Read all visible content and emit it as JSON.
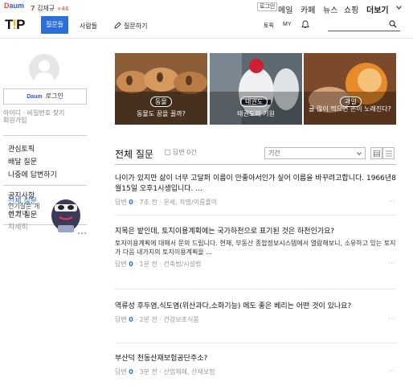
{
  "topbar": {
    "logo_d": "D",
    "logo_rest": "aum",
    "rank_num": "7",
    "rank_keyword": "김재규",
    "rank_change": "+46",
    "login_chip": "로그인",
    "services": [
      "메일",
      "카페",
      "뉴스",
      "쇼핑"
    ],
    "more": "더보기"
  },
  "header": {
    "logo_main": "T",
    "logo_accent": "!",
    "logo_end": "P",
    "tab_question": "질문들",
    "tab_people": "사람들",
    "ask_label": "질문하기",
    "link_topic": "토픽",
    "link_my": "MY"
  },
  "sidebar": {
    "login_daum": "Daum",
    "login_label": "로그인",
    "find_account": "아이디 · 비밀번호 찾기",
    "signup": "회원가입",
    "menu": [
      "관심토픽",
      "배달 질문",
      "나중에 답변하기"
    ],
    "menu2": [
      "전체 질문",
      "인기 질문"
    ],
    "notice_title": "공지사항",
    "notice_text": "인기질문 개선 안내",
    "notice_more": "자세히"
  },
  "cards": [
    {
      "badge": "동물",
      "caption": "동물도 꿈을 꿀까?"
    },
    {
      "badge": "태권도",
      "caption": "태권도의 기원"
    },
    {
      "badge": "과일",
      "caption": "귤 많이 먹으면 손이 노래진다?"
    }
  ],
  "list": {
    "title": "전체 질문",
    "answer_filter": "답변 0건",
    "period_label": "기간"
  },
  "questions": [
    {
      "title": "나이가 있지만 삶이 너무 고달퍼 이름이 안좋아서인가 싶어 이름을 바꾸려고합니다. 1966년8월15일 오후1시생입니다. ...",
      "body": "",
      "answers_label": "답변",
      "answers": "0",
      "time": "7초 전",
      "category": "운세, 작명/이름풀이"
    },
    {
      "title": "지목은 밭인데, 토지이용계획에는 국가하천으로 표기된 것은 하천인가요?",
      "body": "토지이용계획에 대해서 문의 드립니다. 현재, 부동산 종합정보시스템에서 열람해보니, 소유하고 있는 토지가 다음 내가지의 토지이용계획을 ...",
      "answers_label": "답변",
      "answers": "0",
      "time": "1분 전",
      "category": "건축법/시설법"
    },
    {
      "title": "역류성 후두염,식도염(위산과다,소화기능) 에도 좋은 베리는 어떤 것이 있나요?",
      "body": "",
      "answers_label": "답변",
      "answers": "0",
      "time": "2분 전",
      "category": "건강보조식품"
    },
    {
      "title": "부산덕 천동산재보험공단주소?",
      "body": "",
      "answers_label": "답변",
      "answers": "0",
      "time": "3분 전",
      "category": "산업재해, 산재보험"
    }
  ],
  "colors": {
    "accent": "#2c6fd8",
    "daum_red": "#e74c3c",
    "logo_yellow": "#f2b400"
  },
  "icons": [
    "pencil-icon",
    "bell-icon",
    "search-icon",
    "grid-view-icon",
    "list-view-icon",
    "more-dots-icon"
  ]
}
